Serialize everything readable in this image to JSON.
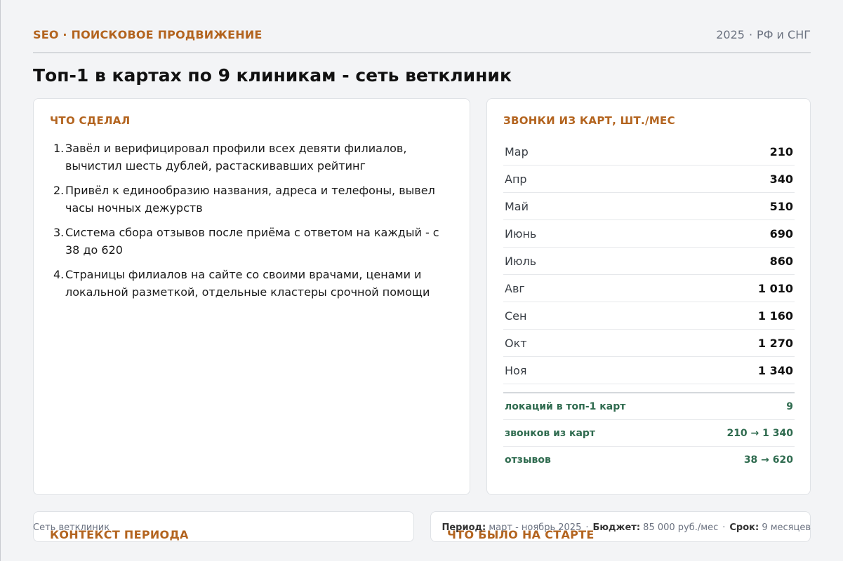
{
  "header": {
    "section_label": "SEO · ПОИСКОВОЕ ПРОДВИЖЕНИЕ",
    "year": "2025",
    "region": "РФ и СНГ"
  },
  "title": "Топ-1 в картах по 9 клиникам - сеть ветклиник",
  "did": {
    "heading": "ЧТО СДЕЛАЛ",
    "items": [
      {
        "num": "1.",
        "text": "Завёл и верифицировал профили всех девяти филиалов, вычистил шесть дублей, растаскивавших рейтинг"
      },
      {
        "num": "2.",
        "text": "Привёл к единообразию названия, адреса и телефоны, вывел часы ночных дежурств"
      },
      {
        "num": "3.",
        "text": "Система сбора отзывов после приёма с ответом на каждый - с 38 до 620"
      },
      {
        "num": "4.",
        "text": "Страницы филиалов на сайте со своими врачами, ценами и локальной разметкой, отдельные кластеры срочной помощи"
      }
    ]
  },
  "calls": {
    "heading": "ЗВОНКИ ИЗ КАРТ, ШТ./МЕС",
    "rows": [
      {
        "month": "Мар",
        "value": "210"
      },
      {
        "month": "Апр",
        "value": "340"
      },
      {
        "month": "Май",
        "value": "510"
      },
      {
        "month": "Июнь",
        "value": "690"
      },
      {
        "month": "Июль",
        "value": "860"
      },
      {
        "month": "Авг",
        "value": "1 010"
      },
      {
        "month": "Сен",
        "value": "1 160"
      },
      {
        "month": "Окт",
        "value": "1 270"
      },
      {
        "month": "Ноя",
        "value": "1 340"
      }
    ],
    "summary": [
      {
        "label": "локаций в топ-1 карт",
        "value": "9"
      },
      {
        "label": "звонков из карт",
        "value": "210 → 1 340"
      },
      {
        "label": "отзывов",
        "value": "38 → 620"
      }
    ]
  },
  "bottom": {
    "context_heading": "КОНТЕКСТ ПЕРИОДА",
    "start_heading": "ЧТО БЫЛО НА СТАРТЕ"
  },
  "footer": {
    "client": "Сеть ветклиник",
    "period_label": "Период:",
    "period_value": "март - ноябрь 2025",
    "budget_label": "Бюджет:",
    "budget_value": "85 000 руб./мес",
    "term_label": "Срок:",
    "term_value": "9 месяцев"
  },
  "colors": {
    "accent": "#b3641f",
    "summary_green": "#2f6b4f",
    "background": "#f3f4f6"
  }
}
